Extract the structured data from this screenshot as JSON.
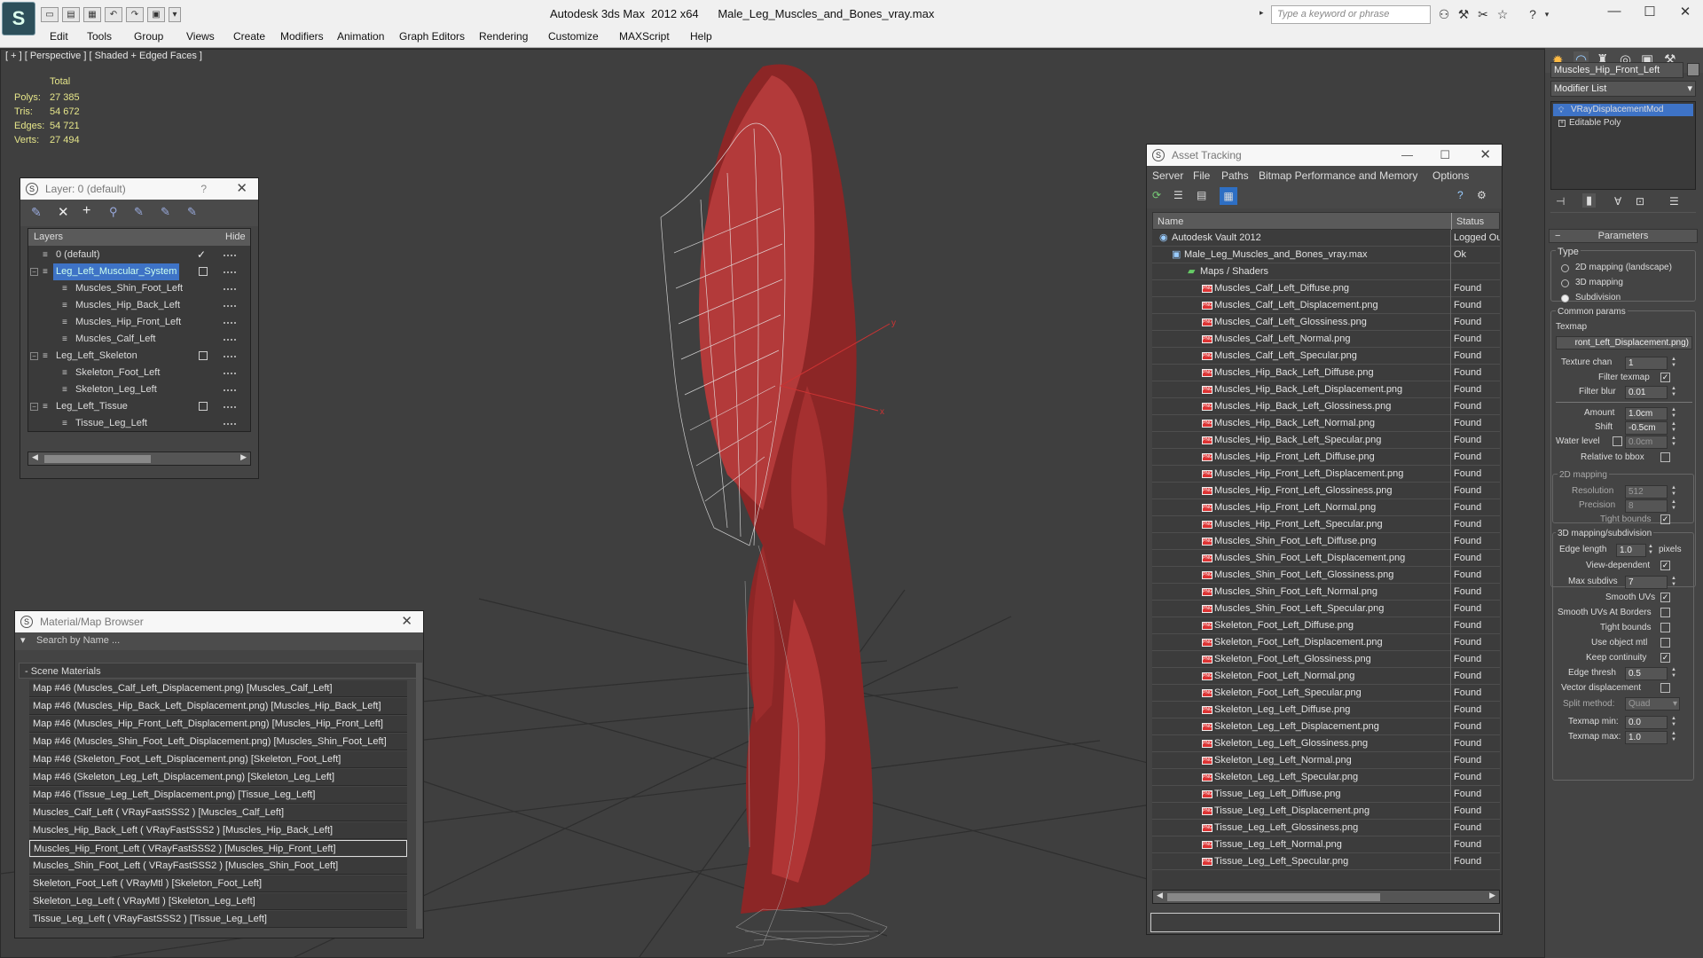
{
  "app": {
    "logo": "3ds-max-logo",
    "product": "Autodesk 3ds Max  2012 x64",
    "file": "Male_Leg_Muscles_and_Bones_vray.max",
    "search_placeholder": "Type a keyword or phrase",
    "window_controls": {
      "minimize": "—",
      "maximize": "☐",
      "close": "✕"
    }
  },
  "menu": [
    "Edit",
    "Tools",
    "Group",
    "Views",
    "Create",
    "Modifiers",
    "Animation",
    "Graph Editors",
    "Rendering",
    "Customize",
    "MAXScript",
    "Help"
  ],
  "viewport": {
    "label": "[ + ] [ Perspective ] [ Shaded + Edged Faces ]",
    "stats": {
      "total_label": "Total",
      "rows": [
        {
          "label": "Polys:",
          "value": "27 385"
        },
        {
          "label": "Tris:",
          "value": "54 672"
        },
        {
          "label": "Edges:",
          "value": "54 721"
        },
        {
          "label": "Verts:",
          "value": "27 494"
        }
      ]
    },
    "gizmo": {
      "x": "x",
      "y": "y"
    }
  },
  "layer_panel": {
    "title": "Layer: 0 (default)",
    "help": "?",
    "col_layers": "Layers",
    "col_hide": "Hide",
    "rows": [
      {
        "name": "0 (default)",
        "level": 0,
        "expander": "",
        "checked": true,
        "selected": false,
        "box": false
      },
      {
        "name": "Leg_Left_Muscular_System",
        "level": 0,
        "expander": "−",
        "checked": false,
        "selected": true,
        "box": true
      },
      {
        "name": "Muscles_Shin_Foot_Left",
        "level": 1,
        "expander": "",
        "checked": false,
        "selected": false,
        "box": false
      },
      {
        "name": "Muscles_Hip_Back_Left",
        "level": 1,
        "expander": "",
        "checked": false,
        "selected": false,
        "box": false
      },
      {
        "name": "Muscles_Hip_Front_Left",
        "level": 1,
        "expander": "",
        "checked": false,
        "selected": false,
        "box": false
      },
      {
        "name": "Muscles_Calf_Left",
        "level": 1,
        "expander": "",
        "checked": false,
        "selected": false,
        "box": false
      },
      {
        "name": "Leg_Left_Skeleton",
        "level": 0,
        "expander": "−",
        "checked": false,
        "selected": false,
        "box": true
      },
      {
        "name": "Skeleton_Foot_Left",
        "level": 1,
        "expander": "",
        "checked": false,
        "selected": false,
        "box": false
      },
      {
        "name": "Skeleton_Leg_Left",
        "level": 1,
        "expander": "",
        "checked": false,
        "selected": false,
        "box": false
      },
      {
        "name": "Leg_Left_Tissue",
        "level": 0,
        "expander": "−",
        "checked": false,
        "selected": false,
        "box": true
      },
      {
        "name": "Tissue_Leg_Left",
        "level": 1,
        "expander": "",
        "checked": false,
        "selected": false,
        "box": false
      }
    ]
  },
  "material_browser": {
    "title": "Material/Map Browser",
    "search_placeholder": "Search by Name ...",
    "group": "- Scene Materials",
    "items": [
      "Map #46 (Muscles_Calf_Left_Displacement.png) [Muscles_Calf_Left]",
      "Map #46 (Muscles_Hip_Back_Left_Displacement.png) [Muscles_Hip_Back_Left]",
      "Map #46 (Muscles_Hip_Front_Left_Displacement.png) [Muscles_Hip_Front_Left]",
      "Map #46 (Muscles_Shin_Foot_Left_Displacement.png) [Muscles_Shin_Foot_Left]",
      "Map #46 (Skeleton_Foot_Left_Displacement.png) [Skeleton_Foot_Left]",
      "Map #46 (Skeleton_Leg_Left_Displacement.png) [Skeleton_Leg_Left]",
      "Map #46 (Tissue_Leg_Left_Displacement.png) [Tissue_Leg_Left]",
      "Muscles_Calf_Left  ( VRayFastSSS2 ) [Muscles_Calf_Left]",
      "Muscles_Hip_Back_Left  ( VRayFastSSS2 ) [Muscles_Hip_Back_Left]",
      "Muscles_Hip_Front_Left  ( VRayFastSSS2 ) [Muscles_Hip_Front_Left]",
      "Muscles_Shin_Foot_Left  ( VRayFastSSS2 ) [Muscles_Shin_Foot_Left]",
      "Skeleton_Foot_Left  ( VRayMtl ) [Skeleton_Foot_Left]",
      "Skeleton_Leg_Left  ( VRayMtl ) [Skeleton_Leg_Left]",
      "Tissue_Leg_Left  ( VRayFastSSS2 ) [Tissue_Leg_Left]"
    ],
    "selected_index": 9
  },
  "asset_tracking": {
    "title": "Asset Tracking",
    "menu": [
      "Server",
      "File",
      "Paths",
      "Bitmap Performance and Memory",
      "Options"
    ],
    "col_name": "Name",
    "col_status": "Status",
    "vault": {
      "name": "Autodesk Vault 2012",
      "status": "Logged Out"
    },
    "file": {
      "name": "Male_Leg_Muscles_and_Bones_vray.max",
      "status": "Ok"
    },
    "maps_folder": "Maps / Shaders",
    "maps": [
      "Muscles_Calf_Left_Diffuse.png",
      "Muscles_Calf_Left_Displacement.png",
      "Muscles_Calf_Left_Glossiness.png",
      "Muscles_Calf_Left_Normal.png",
      "Muscles_Calf_Left_Specular.png",
      "Muscles_Hip_Back_Left_Diffuse.png",
      "Muscles_Hip_Back_Left_Displacement.png",
      "Muscles_Hip_Back_Left_Glossiness.png",
      "Muscles_Hip_Back_Left_Normal.png",
      "Muscles_Hip_Back_Left_Specular.png",
      "Muscles_Hip_Front_Left_Diffuse.png",
      "Muscles_Hip_Front_Left_Displacement.png",
      "Muscles_Hip_Front_Left_Glossiness.png",
      "Muscles_Hip_Front_Left_Normal.png",
      "Muscles_Hip_Front_Left_Specular.png",
      "Muscles_Shin_Foot_Left_Diffuse.png",
      "Muscles_Shin_Foot_Left_Displacement.png",
      "Muscles_Shin_Foot_Left_Glossiness.png",
      "Muscles_Shin_Foot_Left_Normal.png",
      "Muscles_Shin_Foot_Left_Specular.png",
      "Skeleton_Foot_Left_Diffuse.png",
      "Skeleton_Foot_Left_Displacement.png",
      "Skeleton_Foot_Left_Glossiness.png",
      "Skeleton_Foot_Left_Normal.png",
      "Skeleton_Foot_Left_Specular.png",
      "Skeleton_Leg_Left_Diffuse.png",
      "Skeleton_Leg_Left_Displacement.png",
      "Skeleton_Leg_Left_Glossiness.png",
      "Skeleton_Leg_Left_Normal.png",
      "Skeleton_Leg_Left_Specular.png",
      "Tissue_Leg_Left_Diffuse.png",
      "Tissue_Leg_Left_Displacement.png",
      "Tissue_Leg_Left_Glossiness.png",
      "Tissue_Leg_Left_Normal.png",
      "Tissue_Leg_Left_Specular.png"
    ],
    "map_status": "Found"
  },
  "command_panel": {
    "object_name": "Muscles_Hip_Front_Left",
    "modifier_list": "Modifier List",
    "stack": [
      {
        "name": "VRayDisplacementMod",
        "selected": true
      },
      {
        "name": "Editable Poly",
        "selected": false
      }
    ],
    "rollout": "Parameters",
    "type_label": "Type",
    "type_options": [
      "2D mapping (landscape)",
      "3D mapping",
      "Subdivision"
    ],
    "type_selected": 2,
    "common_params": "Common params",
    "texmap_label": "Texmap",
    "texmap_value": "ront_Left_Displacement.png)",
    "texture_chan": {
      "label": "Texture chan",
      "value": "1"
    },
    "filter_texmap": {
      "label": "Filter texmap",
      "checked": true
    },
    "filter_blur": {
      "label": "Filter blur",
      "value": "0.01"
    },
    "amount": {
      "label": "Amount",
      "value": "1.0cm"
    },
    "shift": {
      "label": "Shift",
      "value": "-0.5cm"
    },
    "water_level": {
      "label": "Water level",
      "value": "0.0cm"
    },
    "relative_bbox": {
      "label": "Relative to bbox",
      "checked": false
    },
    "mapping2d": "2D mapping",
    "resolution": {
      "label": "Resolution",
      "value": "512"
    },
    "precision": {
      "label": "Precision",
      "value": "8"
    },
    "tight_bounds_2d": {
      "label": "Tight bounds",
      "checked": true
    },
    "mapping3d": "3D mapping/subdivision",
    "edge_length": {
      "label": "Edge length",
      "value": "1.0",
      "unit": "pixels"
    },
    "view_dependent": {
      "label": "View-dependent",
      "checked": true
    },
    "max_subdivs": {
      "label": "Max subdivs",
      "value": "7"
    },
    "smooth_uvs": {
      "label": "Smooth UVs",
      "checked": true
    },
    "smooth_uvs_borders": {
      "label": "Smooth UVs At Borders",
      "checked": false
    },
    "tight_bounds": {
      "label": "Tight bounds",
      "checked": false
    },
    "use_object_mtl": {
      "label": "Use object mtl",
      "checked": false
    },
    "keep_continuity": {
      "label": "Keep continuity",
      "checked": true
    },
    "edge_thresh": {
      "label": "Edge thresh",
      "value": "0.5"
    },
    "vector_displacement": {
      "label": "Vector displacement",
      "checked": false
    },
    "split_method": {
      "label": "Split method:",
      "value": "Quad"
    },
    "texmap_min": {
      "label": "Texmap min:",
      "value": "0.0"
    },
    "texmap_max": {
      "label": "Texmap max:",
      "value": "1.0"
    }
  }
}
